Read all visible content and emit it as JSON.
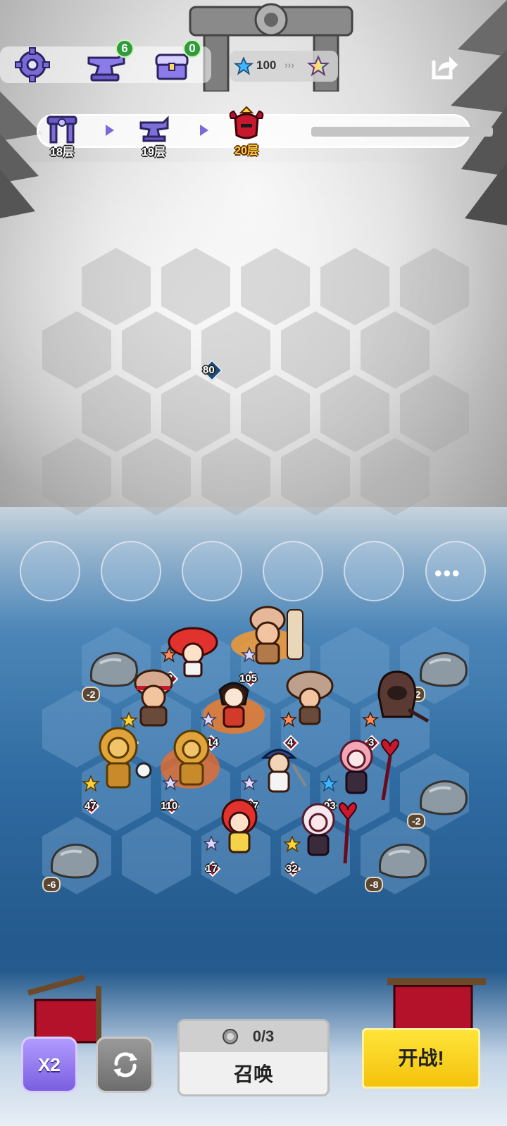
{
  "topbar": {
    "anvil_count": "6",
    "chest_count": "0",
    "star_cost": "100"
  },
  "floors": [
    {
      "label": "18层",
      "icon": "gate-icon"
    },
    {
      "label": "19层",
      "icon": "anvil-icon"
    },
    {
      "label": "20层",
      "icon": "demon-helmet-icon"
    }
  ],
  "enemy_grid": {
    "marker_value": "80"
  },
  "bench": {
    "more_label": "•••"
  },
  "units": [
    {
      "power": "3",
      "star": "orange"
    },
    {
      "power": "105",
      "star": "silver"
    },
    {
      "power": "66",
      "star": "gold"
    },
    {
      "power": "114",
      "star": "silver"
    },
    {
      "power": "4",
      "star": "orange"
    },
    {
      "power": "3",
      "star": "orange"
    },
    {
      "power": "47",
      "star": "gold"
    },
    {
      "power": "110",
      "star": "silver"
    },
    {
      "power": "107",
      "star": "silver"
    },
    {
      "power": "93",
      "star": "blue"
    },
    {
      "power": "17",
      "star": "silver"
    },
    {
      "power": "32",
      "star": "gold"
    }
  ],
  "rocks": [
    "-2",
    "-2",
    "-2",
    "-6",
    "-8"
  ],
  "controls": {
    "speed_label": "X2",
    "summon_cost": "0/3",
    "summon_label": "召唤",
    "fight_label": "开战!"
  },
  "colors": {
    "fight_button": "#f4c20c",
    "speed_button": "#7a5fe0",
    "current_floor": "#ffcc3a",
    "power_diamond": "#b3122a"
  }
}
